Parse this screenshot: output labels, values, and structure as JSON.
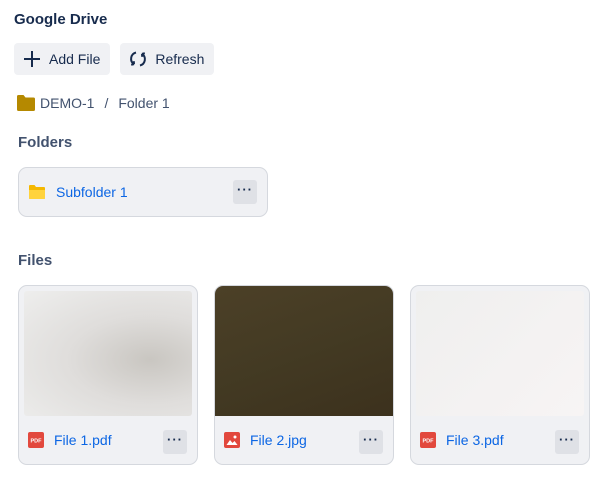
{
  "app": {
    "title": "Google Drive"
  },
  "toolbar": {
    "add_label": "Add File",
    "refresh_label": "Refresh"
  },
  "breadcrumb": {
    "root": "DEMO-1",
    "separator": "/",
    "current": "Folder 1"
  },
  "sections": {
    "folders": "Folders",
    "files": "Files"
  },
  "folders": [
    {
      "name": "Subfolder 1",
      "icon": "folder-icon",
      "menu": "···"
    }
  ],
  "files": [
    {
      "name": "File 1.pdf",
      "icon": "pdf-icon",
      "icon_text": "PDF",
      "menu": "···"
    },
    {
      "name": "File 2.jpg",
      "icon": "image-icon",
      "menu": "···"
    },
    {
      "name": "File 3.pdf",
      "icon": "pdf-icon",
      "icon_text": "PDF",
      "menu": "···"
    }
  ],
  "colors": {
    "link": "#0c66e4",
    "card_bg": "#f0f1f4",
    "folder_icon": "#f5b800",
    "breadcrumb_folder": "#b58900",
    "pdf_icon": "#e2483d",
    "image_icon": "#e2483d"
  }
}
